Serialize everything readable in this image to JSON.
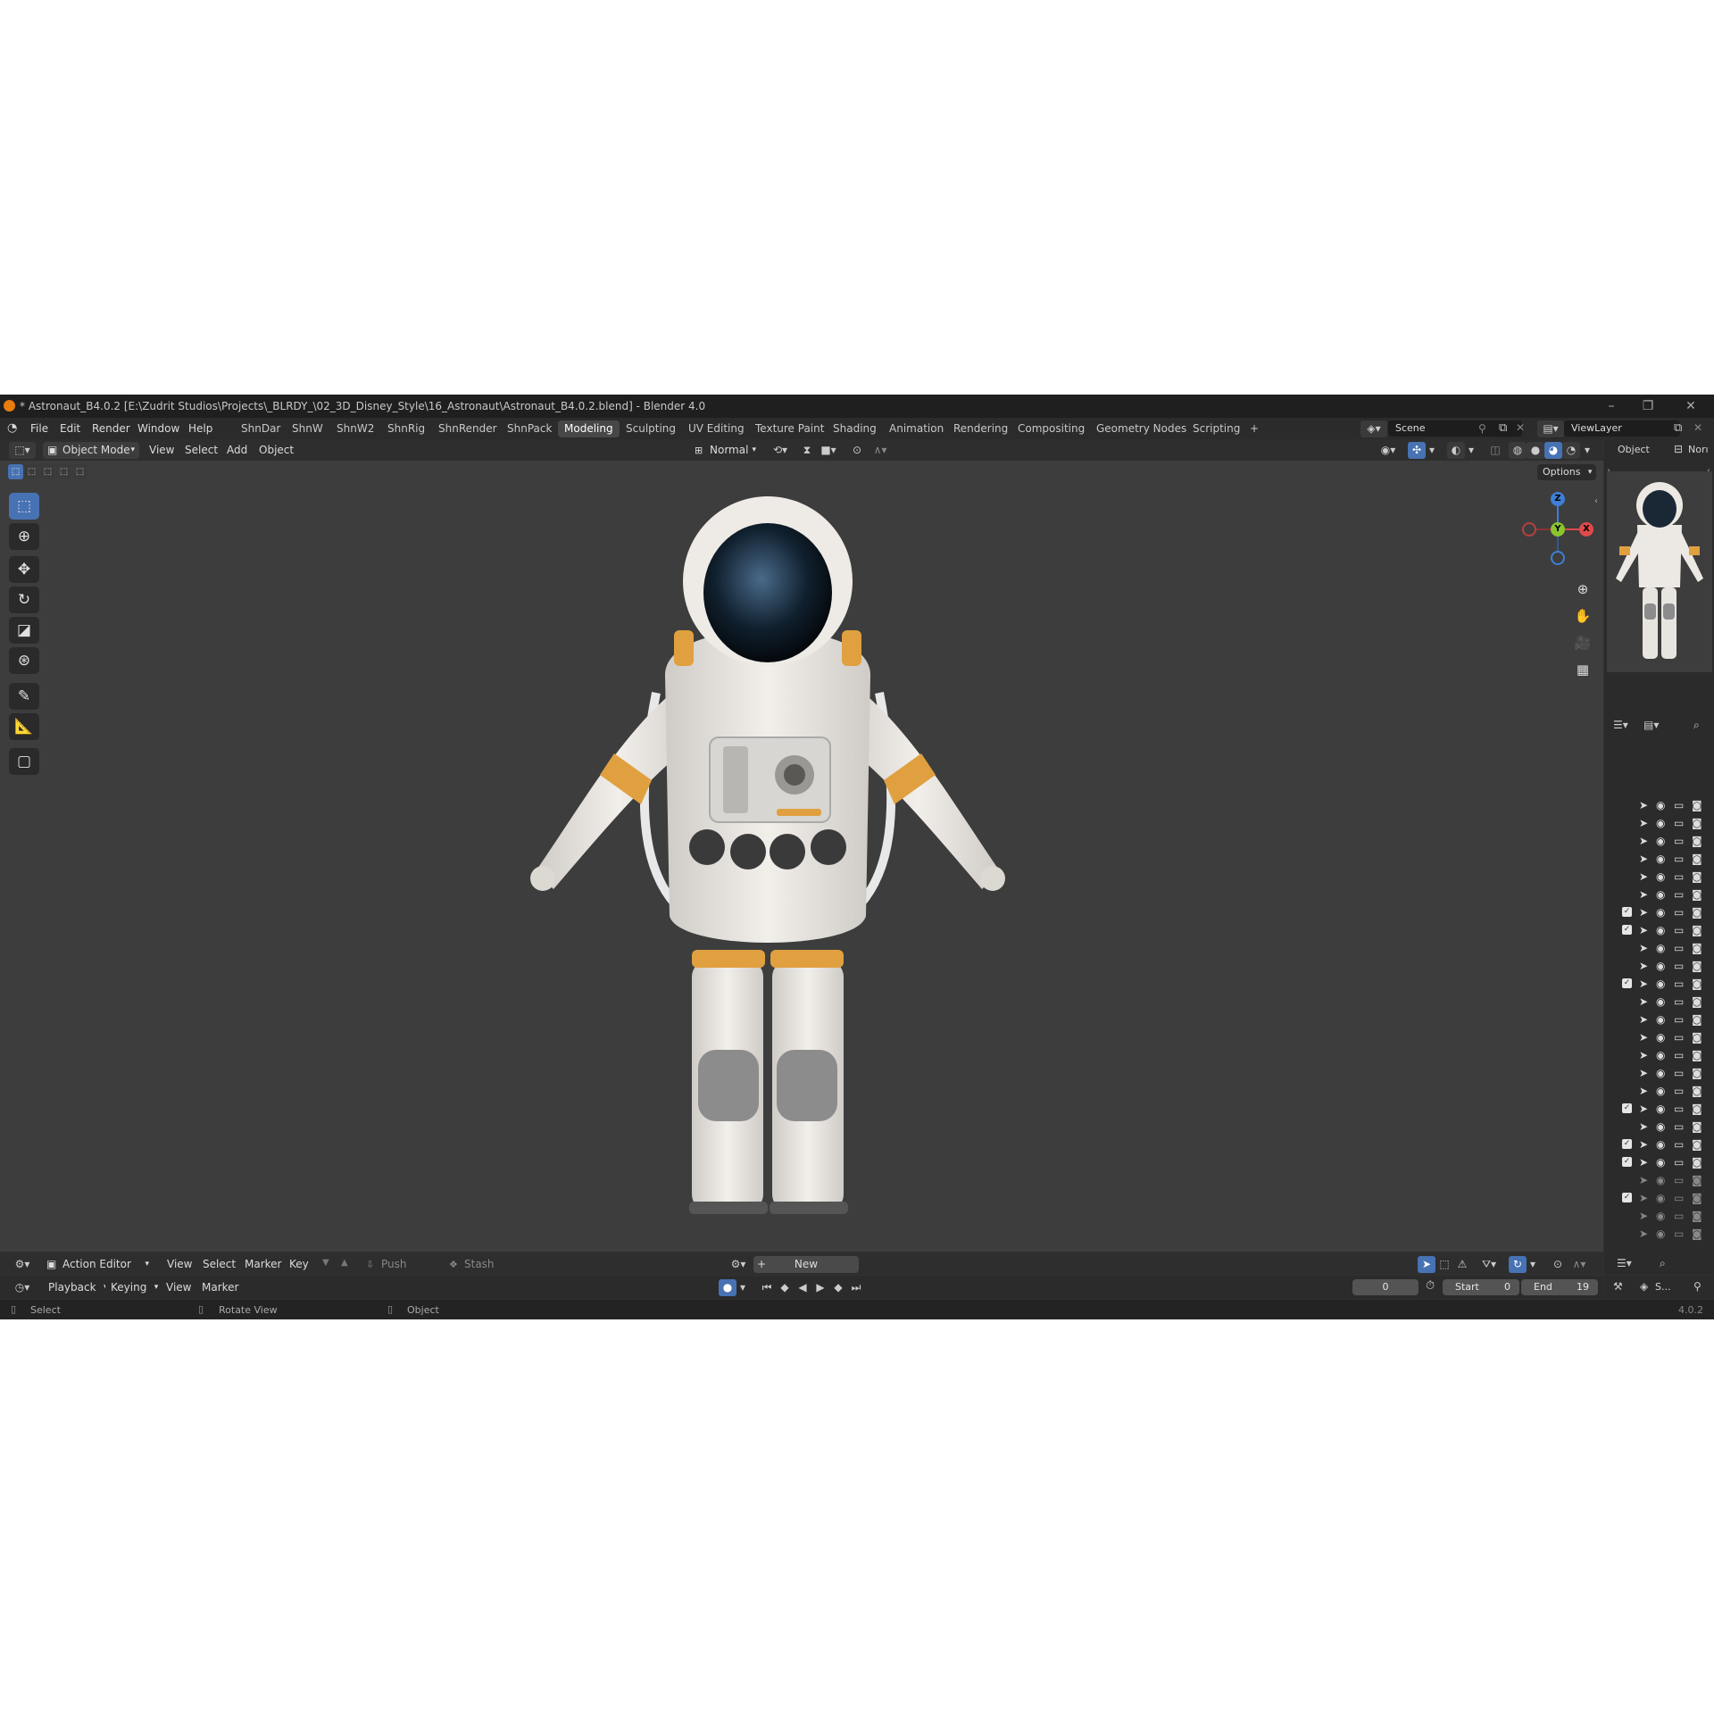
{
  "window": {
    "title": "* Astronaut_B4.0.2 [E:\\Zudrit Studios\\Projects\\_BLRDY_\\02_3D_Disney_Style\\16_Astronaut\\Astronaut_B4.0.2.blend] - Blender 4.0"
  },
  "menu": [
    "File",
    "Edit",
    "Render",
    "Window",
    "Help"
  ],
  "workspaces": [
    "ShnDar",
    "ShnW",
    "ShnW2",
    "ShnRig",
    "ShnRender",
    "ShnPack",
    "Modeling",
    "Sculpting",
    "UV Editing",
    "Texture Paint",
    "Shading",
    "Animation",
    "Rendering",
    "Compositing",
    "Geometry Nodes",
    "Scripting",
    "+"
  ],
  "active_workspace": "Modeling",
  "scene": {
    "name": "Scene",
    "view_layer": "ViewLayer"
  },
  "viewport_header": {
    "mode": "Object Mode",
    "menus": [
      "View",
      "Select",
      "Add",
      "Object"
    ],
    "orientation": "Normal",
    "options": "Options"
  },
  "properties": {
    "tab_object": "Object",
    "tab_normal": "Norı"
  },
  "gizmo": {
    "z": "Z",
    "y": "Y",
    "x": "X"
  },
  "action_editor": {
    "editor": "Action Editor",
    "menus": [
      "View",
      "Select",
      "Marker",
      "Key"
    ],
    "push_down": "Push Down",
    "stash": "Stash",
    "new": "New"
  },
  "timeline": {
    "menus": [
      "Playback",
      "Keying",
      "View",
      "Marker"
    ],
    "current_frame": "0",
    "start_label": "Start",
    "start": "0",
    "end_label": "End",
    "end": "19"
  },
  "outliner": {
    "bottom_label": "S..."
  },
  "status": {
    "select": "Select",
    "rotate": "Rotate View",
    "object": "Object",
    "version": "4.0.2"
  },
  "colors": {
    "accent": "#4772b3",
    "suit_orange": "#e0a040",
    "gizmo_x": "#e04a4a",
    "gizmo_y": "#8ac32f",
    "gizmo_z": "#3f7fd6"
  }
}
